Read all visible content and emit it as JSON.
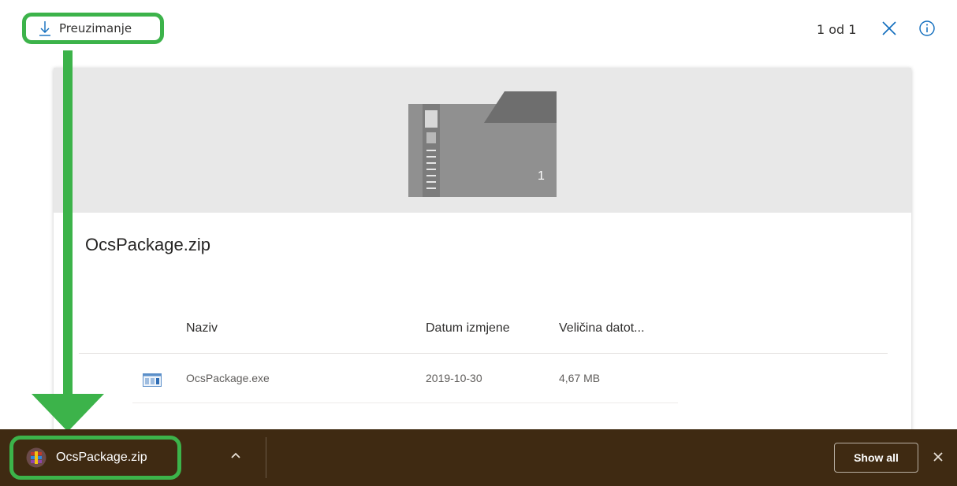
{
  "viewer": {
    "download_label": "Preuzimanje",
    "page_counter": "1 od 1",
    "icons": {
      "download": "download-arrow-icon",
      "close": "close-icon",
      "info": "info-icon"
    }
  },
  "preview": {
    "badge_number": "1",
    "icon": "zip-folder-icon"
  },
  "file": {
    "title": "OcsPackage.zip",
    "columns": [
      "Naziv",
      "Datum izmjene",
      "Veličina datot..."
    ],
    "rows": [
      {
        "name": "OcsPackage.exe",
        "modified": "2019-10-30",
        "size": "4,67 MB",
        "icon": "exe-file-icon"
      }
    ]
  },
  "shelf": {
    "item_name": "OcsPackage.zip",
    "item_icon": "archive-icon",
    "show_all_label": "Show all"
  },
  "colors": {
    "highlight": "#3cb34a",
    "shelf_background": "#3f2a12",
    "preview_background": "#e8e8e8"
  }
}
